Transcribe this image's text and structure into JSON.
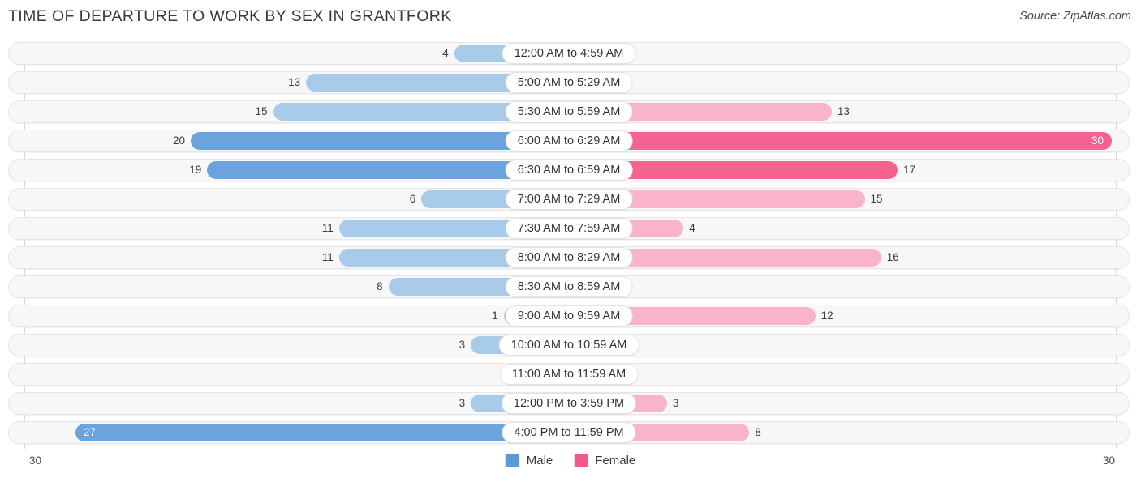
{
  "header": {
    "title": "TIME OF DEPARTURE TO WORK BY SEX IN GRANTFORK",
    "source": "Source: ZipAtlas.com"
  },
  "legend": {
    "male_label": "Male",
    "female_label": "Female",
    "male_color": "#5b9bd5",
    "female_color": "#ee5b8b"
  },
  "axis": {
    "left_cap": "30",
    "right_cap": "30",
    "max": 30
  },
  "chart_data": {
    "type": "bar",
    "title": "TIME OF DEPARTURE TO WORK BY SEX IN GRANTFORK",
    "subtitle": "Source: ZipAtlas.com",
    "orientation": "horizontal-diverging",
    "xlabel": "",
    "ylabel": "",
    "xlim": [
      30,
      30
    ],
    "grid": false,
    "legend_position": "bottom-center",
    "categories": [
      "12:00 AM to 4:59 AM",
      "5:00 AM to 5:29 AM",
      "5:30 AM to 5:59 AM",
      "6:00 AM to 6:29 AM",
      "6:30 AM to 6:59 AM",
      "7:00 AM to 7:29 AM",
      "7:30 AM to 7:59 AM",
      "8:00 AM to 8:29 AM",
      "8:30 AM to 8:59 AM",
      "9:00 AM to 9:59 AM",
      "10:00 AM to 10:59 AM",
      "11:00 AM to 11:59 AM",
      "12:00 PM to 3:59 PM",
      "4:00 PM to 11:59 PM"
    ],
    "series": [
      {
        "name": "Male",
        "values": [
          4,
          13,
          15,
          20,
          19,
          6,
          11,
          11,
          8,
          1,
          3,
          0,
          3,
          27
        ]
      },
      {
        "name": "Female",
        "values": [
          0,
          0,
          13,
          30,
          17,
          15,
          4,
          16,
          0,
          12,
          0,
          0,
          3,
          8
        ]
      }
    ]
  },
  "rows": [
    {
      "label": "12:00 AM to 4:59 AM",
      "male": "4",
      "female": "0"
    },
    {
      "label": "5:00 AM to 5:29 AM",
      "male": "13",
      "female": "0"
    },
    {
      "label": "5:30 AM to 5:59 AM",
      "male": "15",
      "female": "13"
    },
    {
      "label": "6:00 AM to 6:29 AM",
      "male": "20",
      "female": "30"
    },
    {
      "label": "6:30 AM to 6:59 AM",
      "male": "19",
      "female": "17"
    },
    {
      "label": "7:00 AM to 7:29 AM",
      "male": "6",
      "female": "15"
    },
    {
      "label": "7:30 AM to 7:59 AM",
      "male": "11",
      "female": "4"
    },
    {
      "label": "8:00 AM to 8:29 AM",
      "male": "11",
      "female": "16"
    },
    {
      "label": "8:30 AM to 8:59 AM",
      "male": "8",
      "female": "0"
    },
    {
      "label": "9:00 AM to 9:59 AM",
      "male": "1",
      "female": "12"
    },
    {
      "label": "10:00 AM to 10:59 AM",
      "male": "3",
      "female": "0"
    },
    {
      "label": "11:00 AM to 11:59 AM",
      "male": "0",
      "female": "0"
    },
    {
      "label": "12:00 PM to 3:59 PM",
      "male": "3",
      "female": "3"
    },
    {
      "label": "4:00 PM to 11:59 PM",
      "male": "27",
      "female": "8"
    }
  ]
}
